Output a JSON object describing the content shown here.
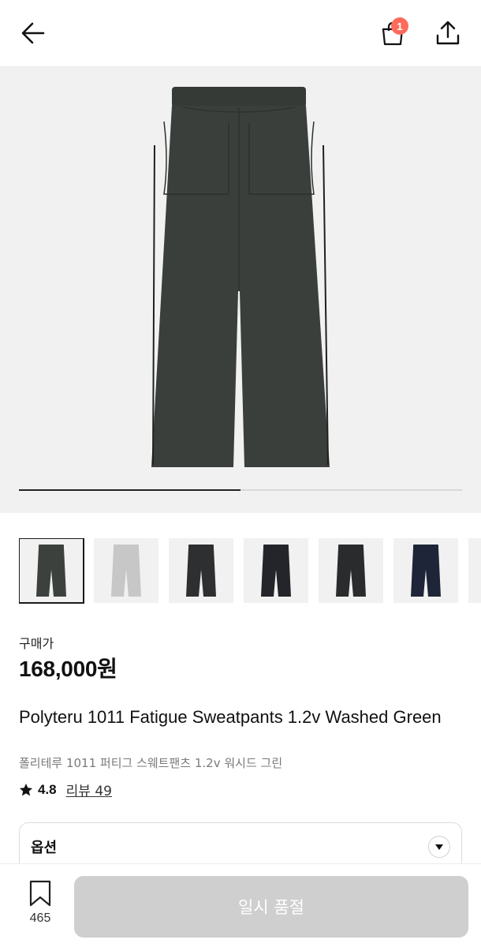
{
  "header": {
    "cart_count": "1"
  },
  "gallery": {
    "progress_fraction": 0.5,
    "main_color": "#3b3f3b",
    "thumbnails": [
      {
        "color": "#3d413d",
        "active": true
      },
      {
        "color": "#c7c7c7",
        "active": false
      },
      {
        "color": "#2e2f31",
        "active": false
      },
      {
        "color": "#23252a",
        "active": false
      },
      {
        "color": "#2a2b2d",
        "active": false
      },
      {
        "color": "#1f2538",
        "active": false
      },
      {
        "color": "#444444",
        "active": false
      }
    ]
  },
  "product": {
    "price_label": "구매가",
    "price": "168,000원",
    "title_en": "Polyteru 1011 Fatigue Sweatpants 1.2v Washed Green",
    "title_ko": "폴리테루 1011 퍼티그 스웨트팬츠 1.2v 워시드 그린",
    "rating": "4.8",
    "review_link": "리뷰 49"
  },
  "options": {
    "label": "옵션"
  },
  "bottom_bar": {
    "wish_count": "465",
    "soldout_label": "일시 품절"
  },
  "colors": {
    "badge": "#ff6b5b",
    "soldout_button": "#cfcfcf"
  }
}
